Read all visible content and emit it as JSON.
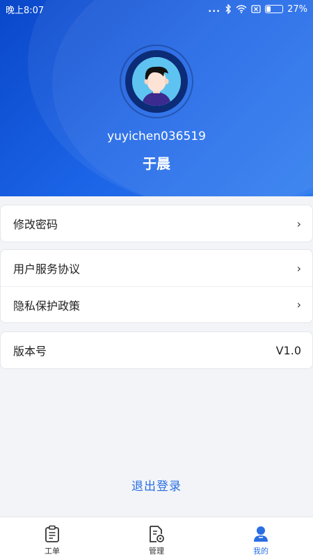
{
  "status_bar": {
    "time": "晚上8:07",
    "dots": "...",
    "battery": "27%",
    "battery_level": 0.27
  },
  "profile": {
    "username": "yuyichen036519",
    "real_name": "于晨"
  },
  "menu": {
    "group1": [
      {
        "label": "修改密码",
        "chevron": "›"
      }
    ],
    "group2": [
      {
        "label": "用户服务协议",
        "chevron": "›"
      },
      {
        "label": "隐私保护政策",
        "chevron": "›"
      }
    ],
    "version": {
      "label": "版本号",
      "value": "V1.0"
    }
  },
  "logout_label": "退出登录",
  "tabs": [
    {
      "label": "工单",
      "icon": "clipboard-icon",
      "active": false
    },
    {
      "label": "管理",
      "icon": "document-settings-icon",
      "active": false
    },
    {
      "label": "我的",
      "icon": "user-icon",
      "active": true
    }
  ],
  "colors": {
    "header_gradient_start": "#0a47c9",
    "header_gradient_end": "#2b7af0",
    "accent": "#2a6fe2",
    "background": "#f2f4f7"
  }
}
